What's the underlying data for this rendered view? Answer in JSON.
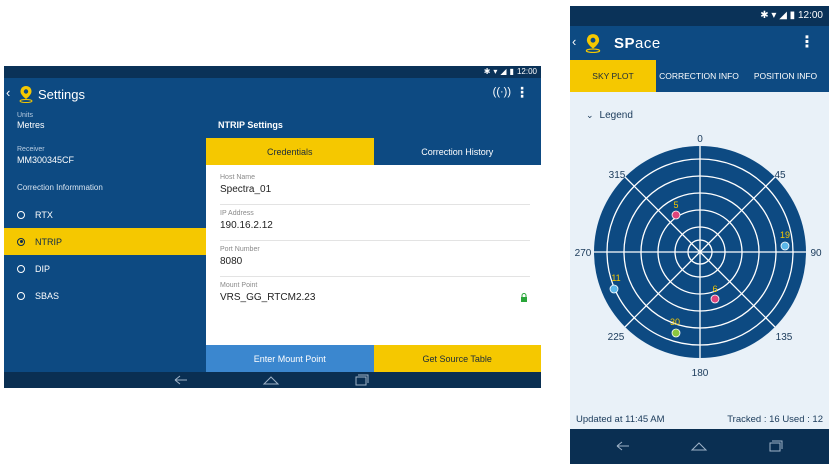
{
  "tablet": {
    "status": {
      "time": "12:00"
    },
    "appbar": {
      "title": "Settings",
      "logo_icon": "map-pin-logo-icon",
      "signal_icon": "antenna-icon",
      "menu_icon": "overflow-menu-icon"
    },
    "left": {
      "units_label": "Units",
      "units_value": "Metres",
      "receiver_label": "Receiver",
      "receiver_value": "MM300345CF",
      "correction_label": "Correction Informmation",
      "options": [
        {
          "label": "RTX",
          "selected": false
        },
        {
          "label": "NTRIP",
          "selected": true
        },
        {
          "label": "DIP",
          "selected": false
        },
        {
          "label": "SBAS",
          "selected": false
        }
      ]
    },
    "right": {
      "header": "NTRIP Settings",
      "tabs": [
        {
          "label": "Credentials",
          "active": true
        },
        {
          "label": "Correction History",
          "active": false
        }
      ],
      "fields": [
        {
          "label": "Host Name",
          "value": "Spectra_01"
        },
        {
          "label": "IP Address",
          "value": "190.16.2.12"
        },
        {
          "label": "Port Number",
          "value": "8080"
        },
        {
          "label": "Mount Point",
          "value": "VRS_GG_RTCM2.23"
        }
      ],
      "buttons": {
        "enter_mount": "Enter Mount Point",
        "get_source": "Get Source Table"
      }
    }
  },
  "phone": {
    "status": {
      "time": "12:00"
    },
    "appbar": {
      "title_bold": "SP",
      "title_rest": "ace",
      "logo_icon": "map-pin-logo-icon",
      "menu_icon": "overflow-menu-icon"
    },
    "tabs": [
      {
        "label": "SKY PLOT",
        "active": true
      },
      {
        "label": "CORRECTION INFO",
        "active": false
      },
      {
        "label": "POSITION INFO",
        "active": false
      }
    ],
    "legend_label": "Legend",
    "skyplot": {
      "bearings": [
        "0",
        "45",
        "90",
        "135",
        "180",
        "225",
        "270",
        "315"
      ],
      "satellites": [
        {
          "id": "5",
          "color": "#e0457b"
        },
        {
          "id": "19",
          "color": "#5bb7e8"
        },
        {
          "id": "11",
          "color": "#5bb7e8"
        },
        {
          "id": "6",
          "color": "#e0457b"
        },
        {
          "id": "30",
          "color": "#8cc63f"
        }
      ]
    },
    "footer": {
      "updated": "Updated at 11:45 AM",
      "tracked": "Tracked : 16  Used : 12"
    }
  },
  "colors": {
    "primary": "#0d4a82",
    "accent": "#f5c800",
    "dark": "#0a2f52"
  }
}
